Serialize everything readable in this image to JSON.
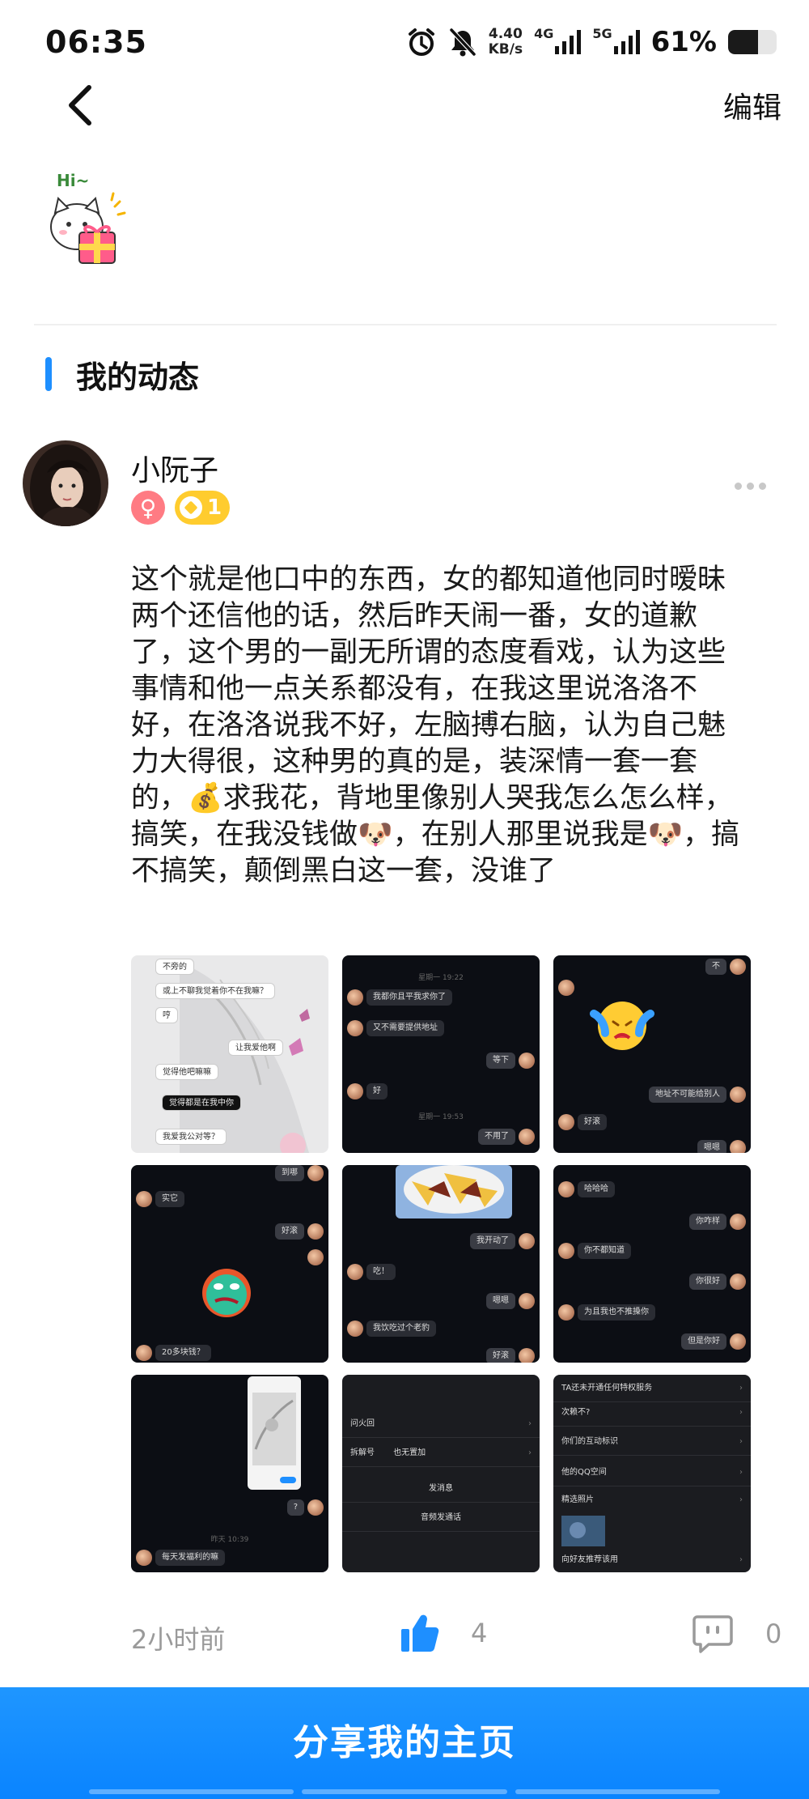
{
  "status_bar": {
    "time": "06:35",
    "net_speed_value": "4.40",
    "net_speed_unit": "KB/s",
    "sim1_label": "4G",
    "sim2_label": "5G",
    "battery_percent": "61%",
    "battery_level": 0.61
  },
  "nav": {
    "edit_label": "编辑"
  },
  "sticker": {
    "text": "Hi~"
  },
  "section": {
    "title": "我的动态"
  },
  "post": {
    "username": "小阮子",
    "gender_symbol": "♀",
    "level": "1",
    "text": "这个就是他口中的东西，女的都知道他同时暧昧两个还信他的话，然后昨天闹一番，女的道歉了，这个男的一副无所谓的态度看戏，认为这些事情和他一点关系都没有，在我这里说洛洛不好，在洛洛说我不好，左脑搏右脑，认为自己魅力大得很，这种男的真的是，装深情一套一套的，💰求我花，背地里像别人哭我怎么怎么样，搞笑，在我没钱做🐶，在别人那里说我是🐶，搞不搞笑，颠倒黑白这一套，没谁了",
    "time": "2小时前",
    "like_count": "4",
    "comment_count": "0",
    "images": {
      "img1": [
        "不旁的",
        "或上不聊我觉着你不在我嘛？",
        "哼",
        "让我爱他啊",
        "觉得他吧嘛嘛",
        "觉得都是在我中你",
        "我爱我公对等？"
      ],
      "img2": [
        "星期一 19:22",
        "我都你且平我求你了",
        "又不需要提供地址",
        "等下",
        "好",
        "星期一 19:53",
        "不用了"
      ],
      "img3": [
        "不",
        "地址不可能给别人",
        "好滚",
        "嗯嗯"
      ],
      "img4": [
        "到哪",
        "实它",
        "好滚",
        "20多块钱？"
      ],
      "img5": [
        "我开动了",
        "吃！",
        "嗯嗯",
        "我饮吃过个老豹",
        "好滚"
      ],
      "img6": [
        "哈哈哈",
        "你咋样",
        "你不都知道",
        "你很好",
        "为且我也不推搡你",
        "但是你好"
      ],
      "img7": [
        "?",
        "昨天 10:39",
        "每天发福利的嘛"
      ],
      "img8": [
        "问火回",
        "拆解号",
        "也无置加",
        "发消息",
        "音频发通话"
      ],
      "img9": [
        "TA还未开通任何特权服务",
        "次赖不?",
        "你们的互动标识",
        "他的QQ空间",
        "精选照片",
        "向好友推荐该用"
      ]
    }
  },
  "share": {
    "label": "分享我的主页"
  },
  "colors": {
    "accent": "#1E8FFF",
    "share_button": "#0A84FF",
    "gender_badge": "#FF7B83",
    "level_badge": "#FFCC2E"
  }
}
